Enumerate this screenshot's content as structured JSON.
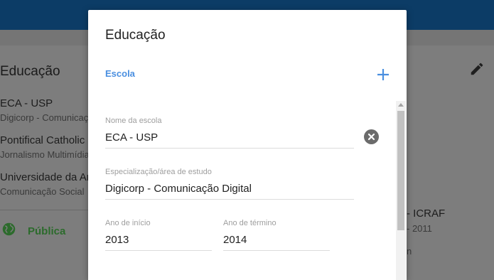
{
  "background": {
    "section_title": "Educação",
    "items": [
      {
        "title": "ECA - USP",
        "subtitle": "Digicorp - Comunicação Digital"
      },
      {
        "title": "Pontifical Catholic University",
        "subtitle": "Jornalismo Multimídia"
      },
      {
        "title": "Universidade da Amazônia",
        "subtitle": "Comunicação Social"
      }
    ],
    "visibility_label": "Pública",
    "right_item": {
      "title": "- ICRAF",
      "subtitle": "- 2011",
      "extra": "n"
    }
  },
  "dialog": {
    "title": "Educação",
    "tab_label": "Escola",
    "fields": {
      "school": {
        "label": "Nome da escola",
        "value": "ECA - USP"
      },
      "area": {
        "label": "Especialização/área de estudo",
        "value": "Digicorp - Comunicação Digital"
      },
      "start_year": {
        "label": "Ano de início",
        "value": "2013"
      },
      "end_year": {
        "label": "Ano de término",
        "value": "2014"
      }
    }
  },
  "colors": {
    "accent": "#4a8fe0",
    "topbar": "#0c3c66",
    "public_green": "#2c6b2c"
  },
  "icons": {
    "add": "plus-icon",
    "clear": "close-circle-icon",
    "edit": "pencil-icon",
    "globe": "globe-icon"
  }
}
